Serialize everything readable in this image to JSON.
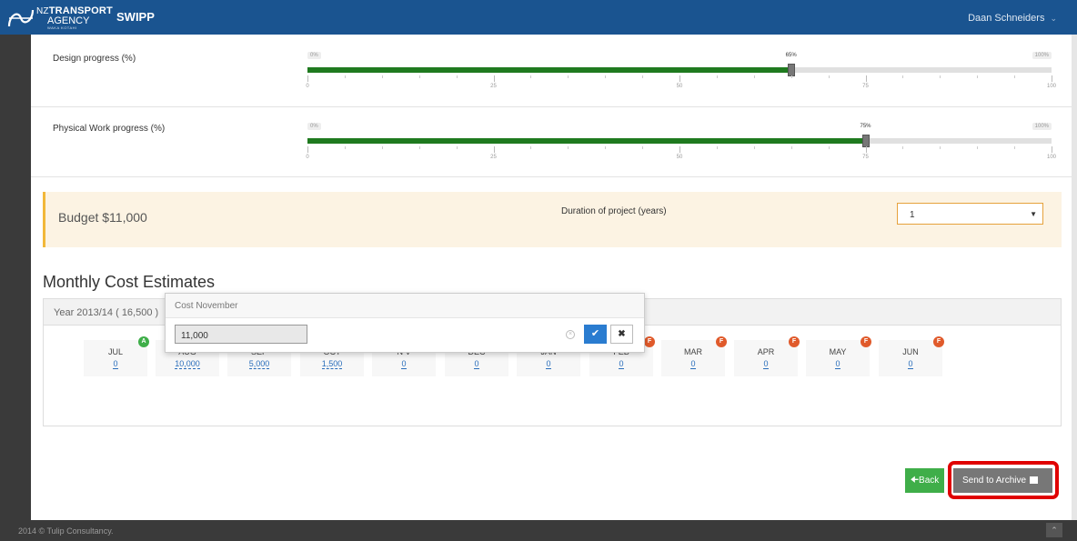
{
  "header": {
    "logo_nz": "NZ",
    "logo_line1": "TRANSPORT",
    "logo_line2": "AGENCY",
    "logo_line3": "WAKA KOTAHI",
    "app_name": "SWIPP",
    "user": "Daan Schneiders"
  },
  "progress": [
    {
      "label": "Design progress (%)",
      "value": 65,
      "value_label": "65%",
      "min_label": "0%",
      "max_label": "100%"
    },
    {
      "label": "Physical Work progress (%)",
      "value": 75,
      "value_label": "75%",
      "min_label": "0%",
      "max_label": "100%"
    }
  ],
  "tick_labels": [
    "0",
    "25",
    "50",
    "75",
    "100"
  ],
  "budget": {
    "label": "Budget $11,000",
    "duration_label": "Duration of project (years)",
    "duration_value": "1"
  },
  "monthly": {
    "title": "Monthly Cost Estimates",
    "year_label": "Year 2013/14 ( 16,500 )",
    "months": [
      {
        "name": "JUL",
        "value": "0",
        "badge": "A",
        "badge_color": "green"
      },
      {
        "name": "AUG",
        "value": "10,000",
        "badge": "",
        "badge_color": ""
      },
      {
        "name": "SEP",
        "value": "5,000",
        "badge": "",
        "badge_color": ""
      },
      {
        "name": "OCT",
        "value": "1,500",
        "badge": "",
        "badge_color": ""
      },
      {
        "name": "N  V",
        "value": "0",
        "badge": "",
        "badge_color": ""
      },
      {
        "name": "DEC",
        "value": "0",
        "badge": "",
        "badge_color": ""
      },
      {
        "name": "JAN",
        "value": "0",
        "badge": "",
        "badge_color": ""
      },
      {
        "name": "FEB",
        "value": "0",
        "badge": "F",
        "badge_color": "red"
      },
      {
        "name": "MAR",
        "value": "0",
        "badge": "F",
        "badge_color": "red"
      },
      {
        "name": "APR",
        "value": "0",
        "badge": "F",
        "badge_color": "red"
      },
      {
        "name": "MAY",
        "value": "0",
        "badge": "F",
        "badge_color": "red"
      },
      {
        "name": "JUN",
        "value": "0",
        "badge": "F",
        "badge_color": "red"
      }
    ]
  },
  "popover": {
    "title": "Cost November",
    "input_value": "11,000"
  },
  "buttons": {
    "back": "Back",
    "archive": "Send to Archive"
  },
  "footer": {
    "text": "2014 © Tulip Consultancy."
  },
  "colors": {
    "header": "#1a5490",
    "progress_fill": "#1f7a1f",
    "budget_bg": "#fcf3e3",
    "budget_accent": "#f2b83a",
    "badge_green": "#3fae49",
    "badge_red": "#e05a2b",
    "back_button": "#3fae49",
    "archive_button": "#777777",
    "highlight": "#e00000"
  }
}
